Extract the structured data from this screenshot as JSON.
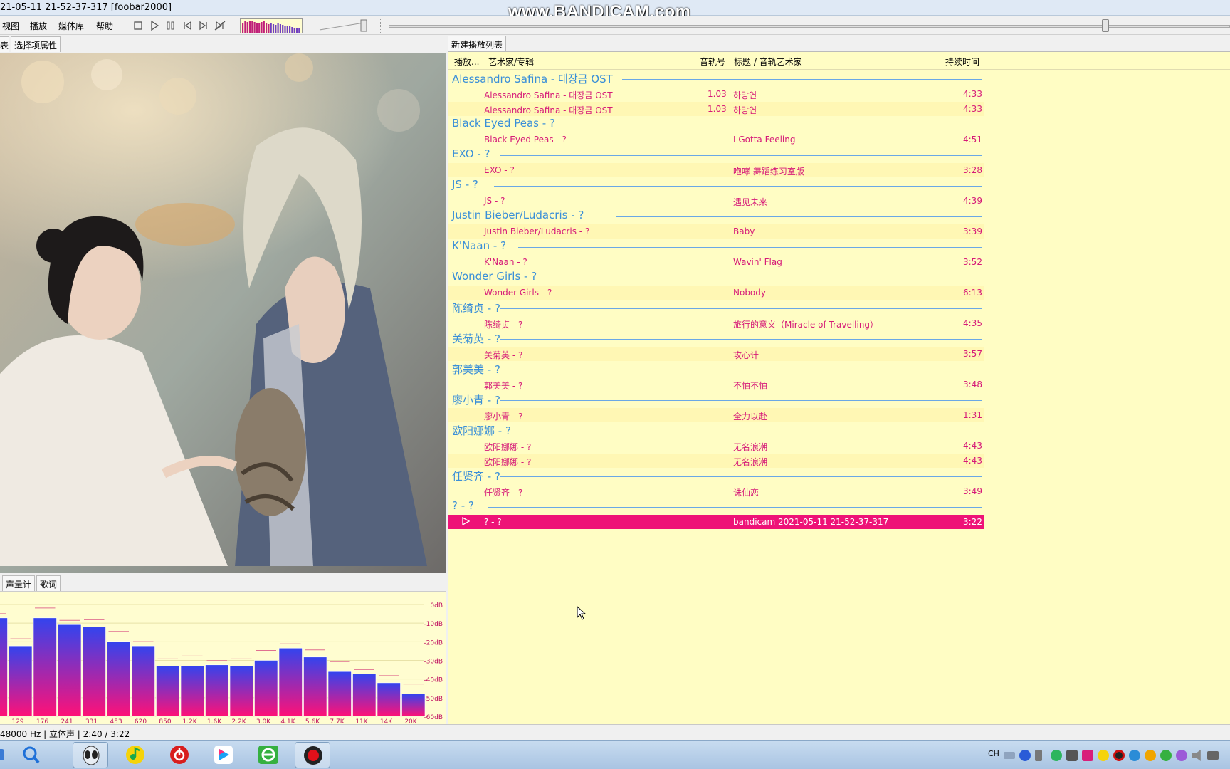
{
  "window": {
    "title": "21-05-11 21-52-37-317  [foobar2000]",
    "watermark": "www.BANDICAM.com"
  },
  "menu": [
    "视图",
    "播放",
    "媒体库",
    "帮助"
  ],
  "toolbar": {
    "icons": [
      "stop-icon",
      "play-icon",
      "pause-icon",
      "previous-icon",
      "next-icon",
      "random-icon"
    ]
  },
  "left_tabs": [
    "表",
    "选择项属性"
  ],
  "spectrum_tabs": [
    "声量计",
    "歌词"
  ],
  "spectrum": {
    "db_labels": [
      "0dB",
      "-10dB",
      "-20dB",
      "-30dB",
      "-40dB",
      "-50dB",
      "-60dB"
    ],
    "freq_labels": [
      "129",
      "176",
      "241",
      "331",
      "453",
      "620",
      "850",
      "1.2K",
      "1.6K",
      "2.2K",
      "3.0K",
      "4.1K",
      "5.6K",
      "7.7K",
      "11K",
      "14K",
      "20K"
    ],
    "bar_colors": {
      "top": "#3344ee",
      "bottom": "#ff1177"
    }
  },
  "playlist": {
    "tab": "新建播放列表",
    "columns": {
      "playing": "播放...",
      "artist_album": "艺术家/专辑",
      "track_no": "音轨号",
      "title_artist": "标题 / 音轨艺术家",
      "duration": "持续时间"
    },
    "groups": [
      {
        "name": "Alessandro Safina - 대장금 OST",
        "tracks": [
          {
            "artist": "Alessandro Safina - 대장금 OST",
            "no": "1.03",
            "title": "하망연",
            "time": "4:33"
          },
          {
            "artist": "Alessandro Safina - 대장금 OST",
            "no": "1.03",
            "title": "하망연",
            "time": "4:33"
          }
        ]
      },
      {
        "name": "Black Eyed Peas - ?",
        "tracks": [
          {
            "artist": "Black Eyed Peas - ?",
            "no": "",
            "title": "I Gotta Feeling",
            "time": "4:51"
          }
        ]
      },
      {
        "name": "EXO - ?",
        "tracks": [
          {
            "artist": "EXO - ?",
            "no": "",
            "title": "咆哮 舞蹈练习室版",
            "time": "3:28"
          }
        ]
      },
      {
        "name": "JS - ?",
        "tracks": [
          {
            "artist": "JS - ?",
            "no": "",
            "title": "遇见未来",
            "time": "4:39"
          }
        ]
      },
      {
        "name": "Justin Bieber/Ludacris - ?",
        "tracks": [
          {
            "artist": "Justin Bieber/Ludacris - ?",
            "no": "",
            "title": "Baby",
            "time": "3:39"
          }
        ]
      },
      {
        "name": "K'Naan - ?",
        "tracks": [
          {
            "artist": "K'Naan - ?",
            "no": "",
            "title": "Wavin' Flag",
            "time": "3:52"
          }
        ]
      },
      {
        "name": "Wonder Girls - ?",
        "tracks": [
          {
            "artist": "Wonder Girls - ?",
            "no": "",
            "title": "Nobody",
            "time": "6:13"
          }
        ]
      },
      {
        "name": "陈绮贞 - ?",
        "tracks": [
          {
            "artist": "陈绮贞 - ?",
            "no": "",
            "title": "旅行的意义（Miracle of Travelling）",
            "time": "4:35"
          }
        ]
      },
      {
        "name": "关菊英 - ?",
        "tracks": [
          {
            "artist": "关菊英 - ?",
            "no": "",
            "title": "攻心计",
            "time": "3:57"
          }
        ]
      },
      {
        "name": "郭美美 - ?",
        "tracks": [
          {
            "artist": "郭美美 - ?",
            "no": "",
            "title": "不怕不怕",
            "time": "3:48"
          }
        ]
      },
      {
        "name": "廖小青 - ?",
        "tracks": [
          {
            "artist": "廖小青 - ?",
            "no": "",
            "title": "全力以赴",
            "time": "1:31"
          }
        ]
      },
      {
        "name": "欧阳娜娜 - ?",
        "tracks": [
          {
            "artist": "欧阳娜娜 - ?",
            "no": "",
            "title": "无名浪潮",
            "time": "4:43"
          },
          {
            "artist": "欧阳娜娜 - ?",
            "no": "",
            "title": "无名浪潮",
            "time": "4:43"
          }
        ]
      },
      {
        "name": "任贤齐 - ?",
        "tracks": [
          {
            "artist": "任贤齐 - ?",
            "no": "",
            "title": "诛仙恋",
            "time": "3:49"
          }
        ]
      },
      {
        "name": "? - ?",
        "tracks": [
          {
            "artist": "? - ?",
            "no": "",
            "title": "bandicam 2021-05-11 21-52-37-317",
            "time": "3:22",
            "playing": true
          }
        ]
      }
    ]
  },
  "status": "48000 Hz | 立体声 | 2:40 / 3:22",
  "taskbar": {
    "apps": [
      "alien-app-icon",
      "qq-music-icon",
      "netease-music-icon",
      "youku-icon",
      "browser-icon",
      "bandicam-record-icon"
    ],
    "tray_text": "CH"
  }
}
